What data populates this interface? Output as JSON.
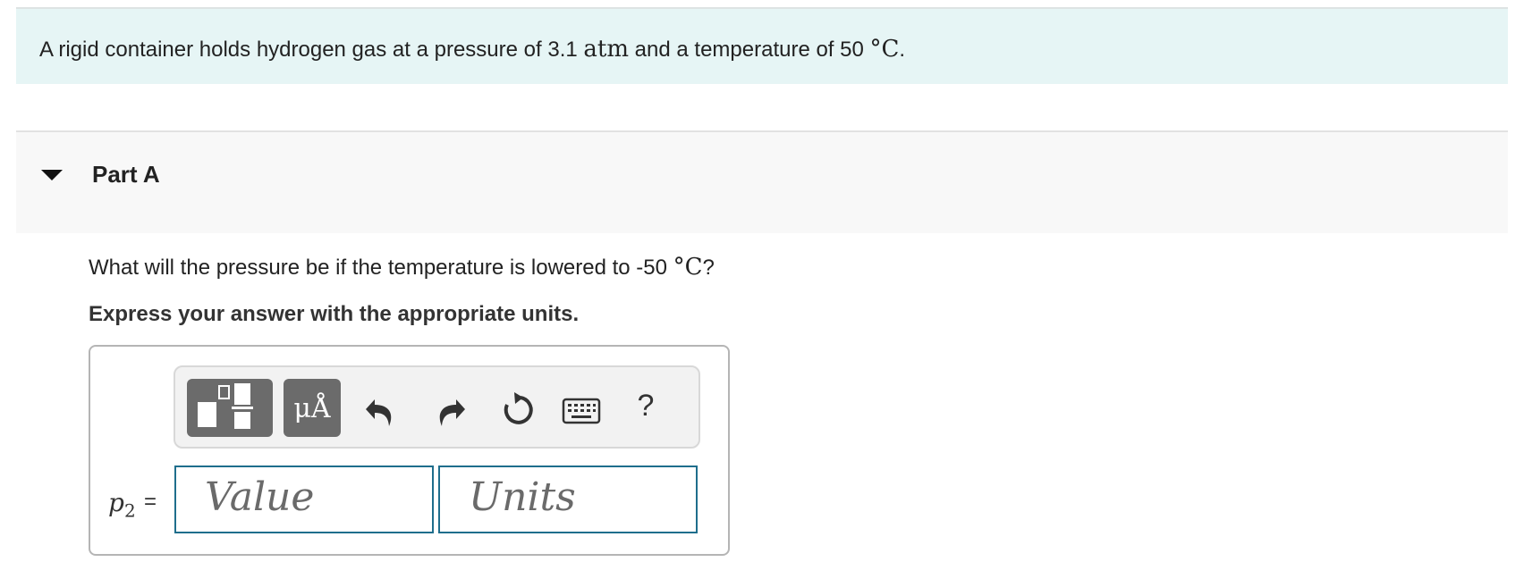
{
  "intro": {
    "text_before": "A rigid container holds hydrogen gas at a pressure of 3.1 ",
    "unit_atm": "atm",
    "text_middle": " and a temperature of 50 ",
    "unit_temp": "°C",
    "text_after": "."
  },
  "part": {
    "title": "Part A",
    "question_before": "What will the pressure be if the temperature is lowered to -50 ",
    "question_unit": "°C",
    "question_after": "?",
    "instruction": "Express your answer with the appropriate units."
  },
  "toolbar": {
    "units_label": "μÅ",
    "help_label": "?",
    "icons": [
      "templates-icon",
      "units-icon",
      "undo-icon",
      "redo-icon",
      "reset-icon",
      "keyboard-icon",
      "help-icon"
    ]
  },
  "answer": {
    "variable": "p",
    "subscript": "2",
    "equals": "=",
    "value_placeholder": "Value",
    "units_placeholder": "Units"
  },
  "colors": {
    "intro_bg": "#e6f5f5",
    "part_header_bg": "#f8f8f8",
    "toolbar_button_bg": "#6b6b6b",
    "input_border": "#1f6e8c"
  }
}
